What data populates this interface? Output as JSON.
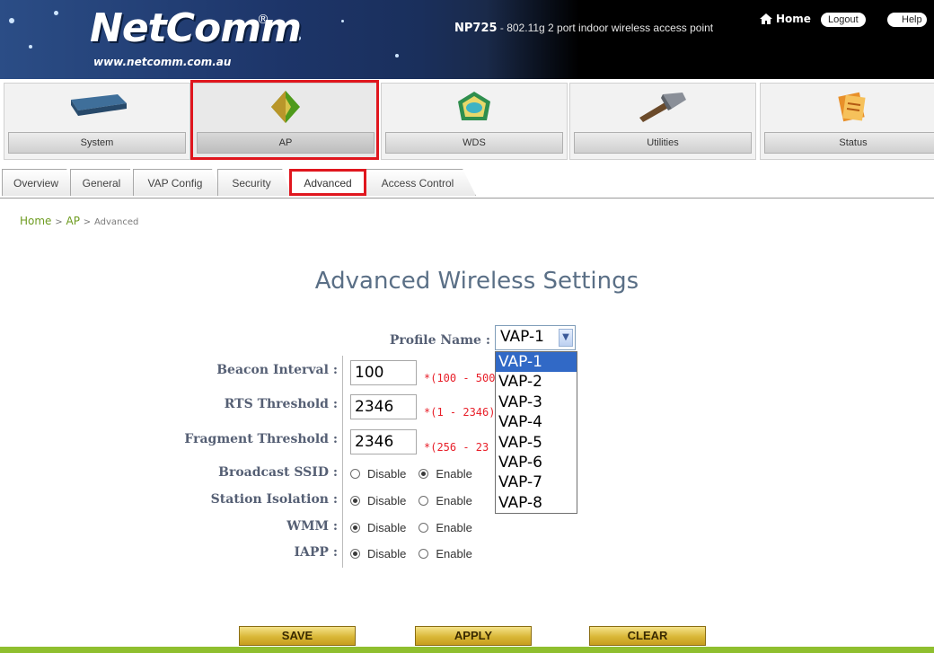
{
  "header": {
    "logo_text": "NetComm",
    "logo_reg": "®",
    "url": "www.netcomm.com.au",
    "model": "NP725",
    "model_desc": " - 802.11g 2 port indoor wireless access point",
    "home_label": "Home",
    "logout_label": "Logout",
    "help_label": "Help"
  },
  "modules": [
    {
      "label": "System"
    },
    {
      "label": "AP"
    },
    {
      "label": "WDS"
    },
    {
      "label": "Utilities"
    },
    {
      "label": "Status"
    }
  ],
  "tabs": [
    {
      "label": "Overview"
    },
    {
      "label": "General"
    },
    {
      "label": "VAP Config"
    },
    {
      "label": "Security"
    },
    {
      "label": "Advanced"
    },
    {
      "label": "Access Control"
    }
  ],
  "breadcrumb": {
    "home": "Home",
    "sep1": ">",
    "ap": "AP",
    "sep2": ">",
    "current": "Advanced"
  },
  "page_title": "Advanced Wireless Settings",
  "form": {
    "profile_label": "Profile Name :",
    "profile_value": "VAP-1",
    "profile_options": [
      "VAP-1",
      "VAP-2",
      "VAP-3",
      "VAP-4",
      "VAP-5",
      "VAP-6",
      "VAP-7",
      "VAP-8"
    ],
    "beacon_label": "Beacon Interval :",
    "beacon_value": "100",
    "beacon_range": "*(100 - 500",
    "rts_label": "RTS Threshold :",
    "rts_value": "2346",
    "rts_range": "*(1 - 2346)",
    "frag_label": "Fragment Threshold :",
    "frag_value": "2346",
    "frag_range": "*(256 - 23",
    "bssid_label": "Broadcast SSID :",
    "iso_label": "Station Isolation :",
    "wmm_label": "WMM :",
    "iapp_label": "IAPP :",
    "disable": "Disable",
    "enable": "Enable"
  },
  "buttons": {
    "save": "SAVE",
    "apply": "APPLY",
    "clear": "CLEAR"
  },
  "colors": {
    "highlight": "#e0161e",
    "accent_green": "#8fbf2f",
    "title": "#5a6f86",
    "range_red": "#e8202a"
  }
}
